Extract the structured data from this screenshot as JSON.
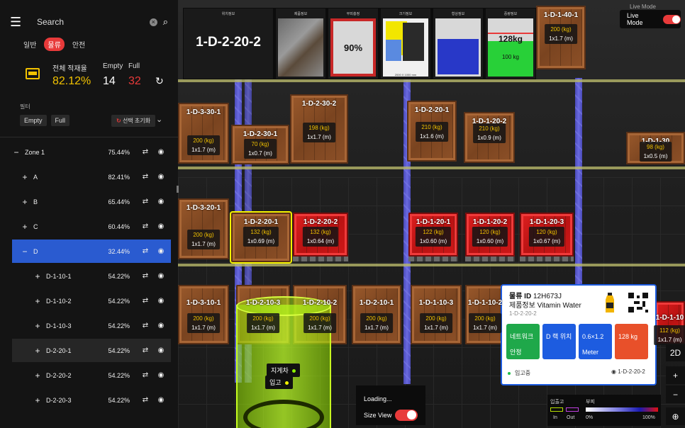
{
  "sidebar": {
    "search_placeholder": "Search",
    "categories": [
      "일반",
      "물류",
      "안전"
    ],
    "stats": {
      "label_rate": "전체 적재율",
      "rate": "82.12%",
      "label_empty": "Empty",
      "empty": "14",
      "label_full": "Full",
      "full": "32"
    },
    "filter_title": "필터",
    "filter_chips": [
      "Empty",
      "Full"
    ],
    "reset_label": "선택 초기화",
    "tree": [
      {
        "label": "Zone 1",
        "pct": "75.44%",
        "sign": "−"
      },
      {
        "label": "A",
        "pct": "82.41%",
        "sign": "+"
      },
      {
        "label": "B",
        "pct": "65.44%",
        "sign": "+"
      },
      {
        "label": "C",
        "pct": "60.44%",
        "sign": "+"
      },
      {
        "label": "D",
        "pct": "32.44%",
        "sign": "−"
      },
      {
        "label": "D-1-10-1",
        "pct": "54.22%",
        "sign": "+"
      },
      {
        "label": "D-1-10-2",
        "pct": "54.22%",
        "sign": "+"
      },
      {
        "label": "D-1-10-3",
        "pct": "54.22%",
        "sign": "+"
      },
      {
        "label": "D-2-20-1",
        "pct": "54.22%",
        "sign": "+"
      },
      {
        "label": "D-2-20-2",
        "pct": "54.22%",
        "sign": "+"
      },
      {
        "label": "D-2-20-3",
        "pct": "54.22%",
        "sign": "+"
      }
    ]
  },
  "thumbs": {
    "t0": "위치정보",
    "t1": "제품정보",
    "t2": "부피충정",
    "t3": "크기정보",
    "t4": "형상정보",
    "t5": "중량정보",
    "location": "1-D-2-20-2",
    "volume": "90%",
    "weight_big": "128kg",
    "weight_small": "100 kg",
    "dims": "2000 X 1000 mm"
  },
  "scene": {
    "crates": [
      {
        "id": "1-D-1-40-1",
        "w": "200 (kg)",
        "d": "1x1.7 (m)"
      },
      {
        "id": "1-D-3-30-1",
        "w": "200 (kg)",
        "d": "1x1.7 (m)"
      },
      {
        "id": "1-D-2-30-1",
        "w": "70 (kg)",
        "d": "1x0.7 (m)"
      },
      {
        "id": "1-D-2-30-2",
        "w": "198 (kg)",
        "d": "1x1.7 (m)"
      },
      {
        "id": "1-D-2-20-1",
        "w": "210 (kg)",
        "d": "1x1.6 (m)"
      },
      {
        "id": "1-D-1-20-2",
        "w": "210 (kg)",
        "d": "1x0.9 (m)"
      },
      {
        "id": "1-D-1-30",
        "w": "98 (kg)",
        "d": "1x0.5 (m)"
      },
      {
        "id": "1-D-3-20-1",
        "w": "200 (kg)",
        "d": "1x1.7 (m)"
      },
      {
        "id": "1-D-2-20-1",
        "w": "132 (kg)",
        "d": "1x0.69 (m)"
      },
      {
        "id": "1-D-2-20-2",
        "w": "132 (kg)",
        "d": "1x0.64 (m)"
      },
      {
        "id": "1-D-1-20-1",
        "w": "122 (kg)",
        "d": "1x0.60 (m)"
      },
      {
        "id": "1-D-1-20-2",
        "w": "120 (kg)",
        "d": "1x0.60 (m)"
      },
      {
        "id": "1-D-1-20-3",
        "w": "120 (kg)",
        "d": "1x0.67 (m)"
      },
      {
        "id": "1-D-3-10-1",
        "w": "200 (kg)",
        "d": "1x1.7 (m)"
      },
      {
        "id": "1-D-2-10-3",
        "w": "200 (kg)",
        "d": "1x1.7 (m)"
      },
      {
        "id": "1-D-2-10-2",
        "w": "200 (kg)",
        "d": "1x1.7 (m)"
      },
      {
        "id": "1-D-2-10-1",
        "w": "200 (kg)",
        "d": "1x1.7 (m)"
      },
      {
        "id": "1-D-1-10-3",
        "w": "200 (kg)",
        "d": "1x1.7 (m)"
      },
      {
        "id": "1-D-1-10-2",
        "w": "200 (kg)",
        "d": "1x1.7 (m)"
      },
      {
        "id": "1-D-1-10",
        "w": "112 (kg)",
        "d": "1x1.7 (m)"
      }
    ],
    "forklift_label": "지게차",
    "inbound_label": "입고"
  },
  "live_mode": {
    "top": "Live Mode",
    "label": "Live Mode"
  },
  "card": {
    "id_label": "물류 ID",
    "id_value": "12H673J",
    "product": "제품정보 Vitamin Water",
    "location": "1-D-2-20-2",
    "tiles": [
      {
        "text": "네트워크 안정",
        "color": "#1fa84a"
      },
      {
        "text": "D 랙 위치",
        "color": "#1d5ce0"
      },
      {
        "text": "0.6×1.2 Meter",
        "color": "#1d5ce0"
      },
      {
        "text": "128 kg",
        "color": "#e8502a"
      }
    ],
    "status": "입고중",
    "status_loc": "1-D-2-20-2"
  },
  "controls": {
    "mode": "2D",
    "zoom_in": "+",
    "zoom_out": "−"
  },
  "loading": {
    "text": "Loading...",
    "size_view": "Size View"
  },
  "legend": {
    "title_io": "입출고",
    "title_vol": "부피",
    "in": "In",
    "out": "Out",
    "min": "0%",
    "max": "100%"
  }
}
